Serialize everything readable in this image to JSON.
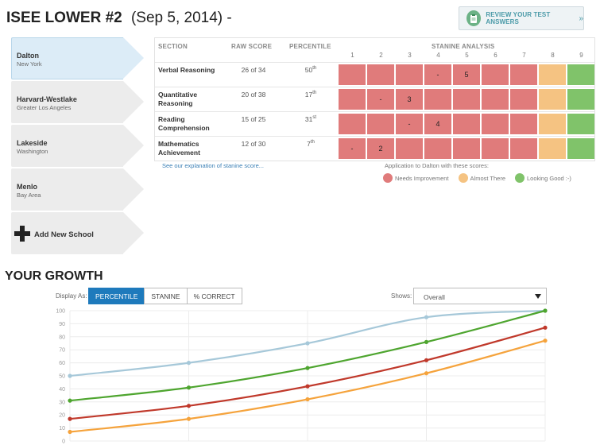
{
  "header": {
    "title": "ISEE LOWER #2",
    "date": "(Sep 5, 2014)",
    "suffix": "-",
    "review_button": "REVIEW YOUR TEST ANSWERS",
    "review_arrows": "»"
  },
  "schools": [
    {
      "name": "Dalton",
      "location": "New York"
    },
    {
      "name": "Harvard-Westlake",
      "location": "Greater Los Angeles"
    },
    {
      "name": "Lakeside",
      "location": "Washington"
    },
    {
      "name": "Menlo",
      "location": "Bay Area"
    }
  ],
  "add_school_label": "Add New School",
  "table": {
    "headers": {
      "section": "SECTION",
      "raw": "RAW SCORE",
      "percentile": "PERCENTILE",
      "stanine": "STANINE ANALYSIS"
    },
    "stanine_numbers": [
      "1",
      "2",
      "3",
      "4",
      "5",
      "6",
      "7",
      "8",
      "9"
    ],
    "rows": [
      {
        "section": "Verbal Reasoning",
        "raw": "26 of 34",
        "pct": "50",
        "pct_suffix": "th",
        "marks": [
          "",
          "",
          "",
          "-",
          "5",
          "",
          "",
          "",
          ""
        ]
      },
      {
        "section": "Quantitative Reasoning",
        "raw": "20 of 38",
        "pct": "17",
        "pct_suffix": "th",
        "marks": [
          "",
          "-",
          "3",
          "",
          "",
          "",
          "",
          "",
          ""
        ]
      },
      {
        "section": "Reading Comprehension",
        "raw": "15 of 25",
        "pct": "31",
        "pct_suffix": "st",
        "marks": [
          "",
          "",
          "-",
          "4",
          "",
          "",
          "",
          "",
          ""
        ]
      },
      {
        "section": "Mathematics Achievement",
        "raw": "12 of 30",
        "pct": "7",
        "pct_suffix": "th",
        "marks": [
          "-",
          "2",
          "",
          "",
          "",
          "",
          "",
          "",
          ""
        ]
      }
    ],
    "cell_colors": [
      "red",
      "red",
      "red",
      "red",
      "red",
      "red",
      "red",
      "yel",
      "grn"
    ]
  },
  "explain_link": "See our explanation of stanine score...",
  "legend": {
    "title": "Application to Dalton with these scores:",
    "items": [
      {
        "label": "Needs Improvement",
        "color": "#e07b7b"
      },
      {
        "label": "Almost There",
        "color": "#f5c382"
      },
      {
        "label": "Looking Good :-)",
        "color": "#80c36a"
      }
    ]
  },
  "growth": {
    "title": "YOUR GROWTH",
    "display_as_label": "Display As:",
    "buttons": [
      {
        "label": "PERCENTILE",
        "active": true
      },
      {
        "label": "STANINE",
        "active": false
      },
      {
        "label": "% CORRECT",
        "active": false
      }
    ],
    "shows_label": "Shows:",
    "shows_value": "Overall"
  },
  "chart_data": {
    "type": "line",
    "ylim": [
      0,
      100
    ],
    "yticks": [
      0,
      10,
      20,
      30,
      40,
      50,
      60,
      70,
      80,
      90,
      100
    ],
    "x": [
      0,
      1,
      2,
      3,
      4
    ],
    "grid": true,
    "series": [
      {
        "color": "#a6c8d9",
        "values": [
          50,
          60,
          75,
          95,
          100
        ]
      },
      {
        "color": "#4ea52f",
        "values": [
          31,
          41,
          56,
          76,
          100
        ]
      },
      {
        "color": "#c0392b",
        "values": [
          17,
          27,
          42,
          62,
          87
        ]
      },
      {
        "color": "#f5a33c",
        "values": [
          7,
          17,
          32,
          52,
          77
        ]
      }
    ]
  }
}
